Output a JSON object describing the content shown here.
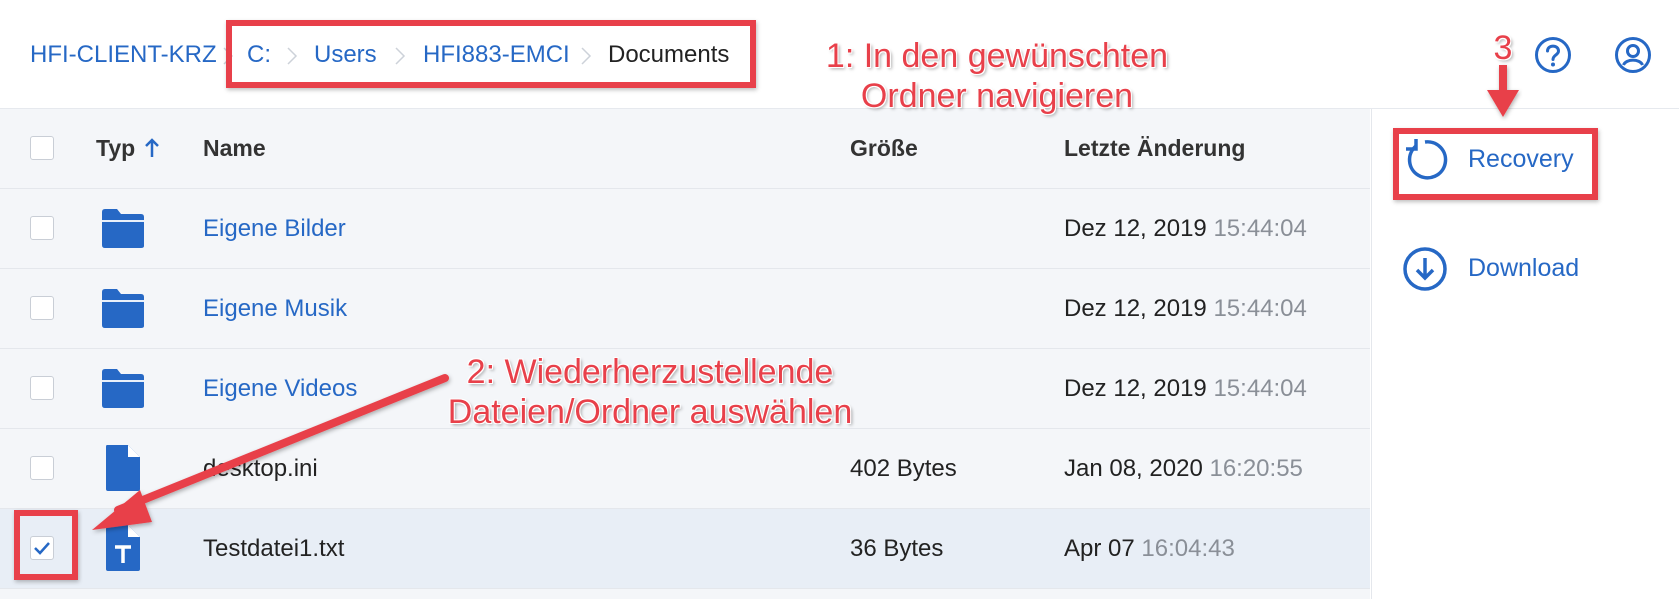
{
  "breadcrumb": {
    "root": "HFI-CLIENT-KRZ",
    "items": [
      "C:",
      "Users",
      "HFI883-EMCI",
      "Documents"
    ]
  },
  "header_icons": [
    "help-icon",
    "account-icon"
  ],
  "table": {
    "columns": {
      "type": "Typ",
      "name": "Name",
      "size": "Größe",
      "modified": "Letzte Änderung"
    },
    "sort_icon": "arrow-up-icon",
    "rows": [
      {
        "icon": "folder-icon",
        "name": "Eigene Bilder",
        "size": "",
        "date": "Dez 12, 2019",
        "time": "15:44:04",
        "checked": false
      },
      {
        "icon": "folder-icon",
        "name": "Eigene Musik",
        "size": "",
        "date": "Dez 12, 2019",
        "time": "15:44:04",
        "checked": false
      },
      {
        "icon": "folder-icon",
        "name": "Eigene Videos",
        "size": "",
        "date": "Dez 12, 2019",
        "time": "15:44:04",
        "checked": false
      },
      {
        "icon": "file-icon",
        "name": "desktop.ini",
        "size": "402 Bytes",
        "date": "Jan 08, 2020",
        "time": "16:20:55",
        "checked": false
      },
      {
        "icon": "text-file-icon",
        "name": "Testdatei1.txt",
        "size": "36 Bytes",
        "date": "Apr 07",
        "time": "16:04:43",
        "checked": true
      }
    ]
  },
  "actions": {
    "recovery": "Recovery",
    "download": "Download"
  },
  "annotations": {
    "step1_line1": "1: In den gewünschten",
    "step1_line2": "Ordner navigieren",
    "step2_line1": "2: Wiederherzustellende",
    "step2_line2": "Dateien/Ordner auswählen",
    "step3": "3"
  },
  "colors": {
    "accent": "#2668c5",
    "annotation": "#e8404a",
    "list_bg": "#f4f6f9"
  }
}
